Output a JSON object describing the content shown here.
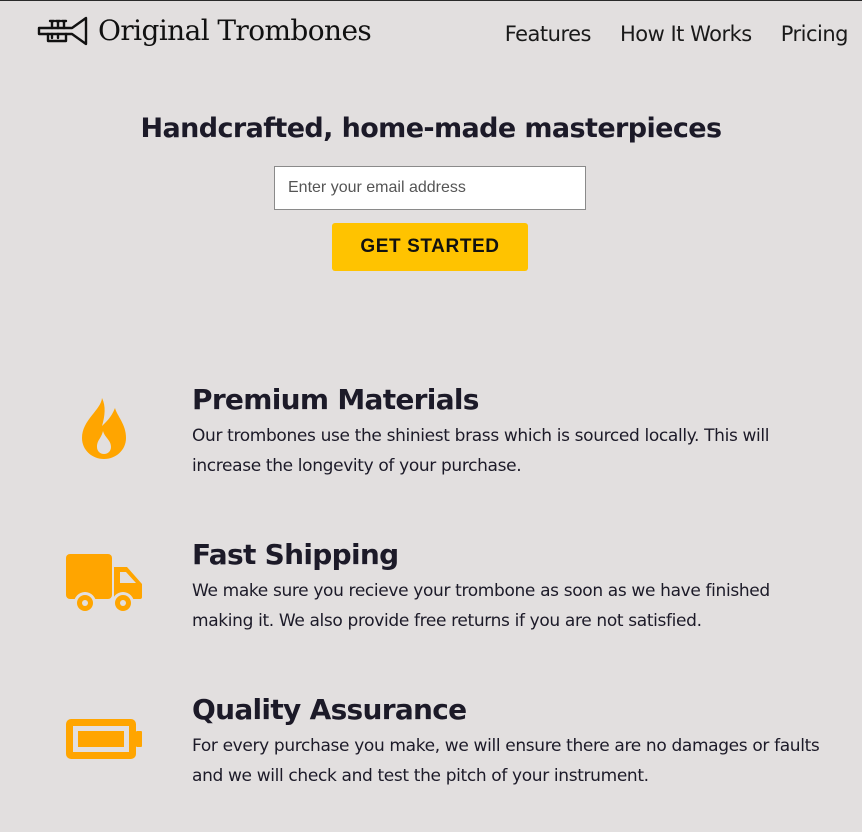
{
  "brand": {
    "name": "Original Trombones",
    "logo_icon": "trumpet-icon"
  },
  "nav": {
    "links": [
      {
        "label": "Features"
      },
      {
        "label": "How It Works"
      },
      {
        "label": "Pricing"
      }
    ]
  },
  "hero": {
    "title": "Handcrafted, home-made masterpieces",
    "email_placeholder": "Enter your email address",
    "email_value": "",
    "cta_label": "GET STARTED"
  },
  "features": [
    {
      "icon": "fire-icon",
      "title": "Premium Materials",
      "description": "Our trombones use the shiniest brass which is sourced locally. This will increase the longevity of your purchase."
    },
    {
      "icon": "truck-icon",
      "title": "Fast Shipping",
      "description": "We make sure you recieve your trombone as soon as we have finished making it. We also provide free returns if you are not satisfied."
    },
    {
      "icon": "battery-icon",
      "title": "Quality Assurance",
      "description": "For every purchase you make, we will ensure there are no damages or faults and we will check and test the pitch of your instrument."
    }
  ],
  "colors": {
    "background": "#e2dfdf",
    "accent": "#ffc300",
    "icon": "#ffa500",
    "text": "#1c1a28"
  }
}
